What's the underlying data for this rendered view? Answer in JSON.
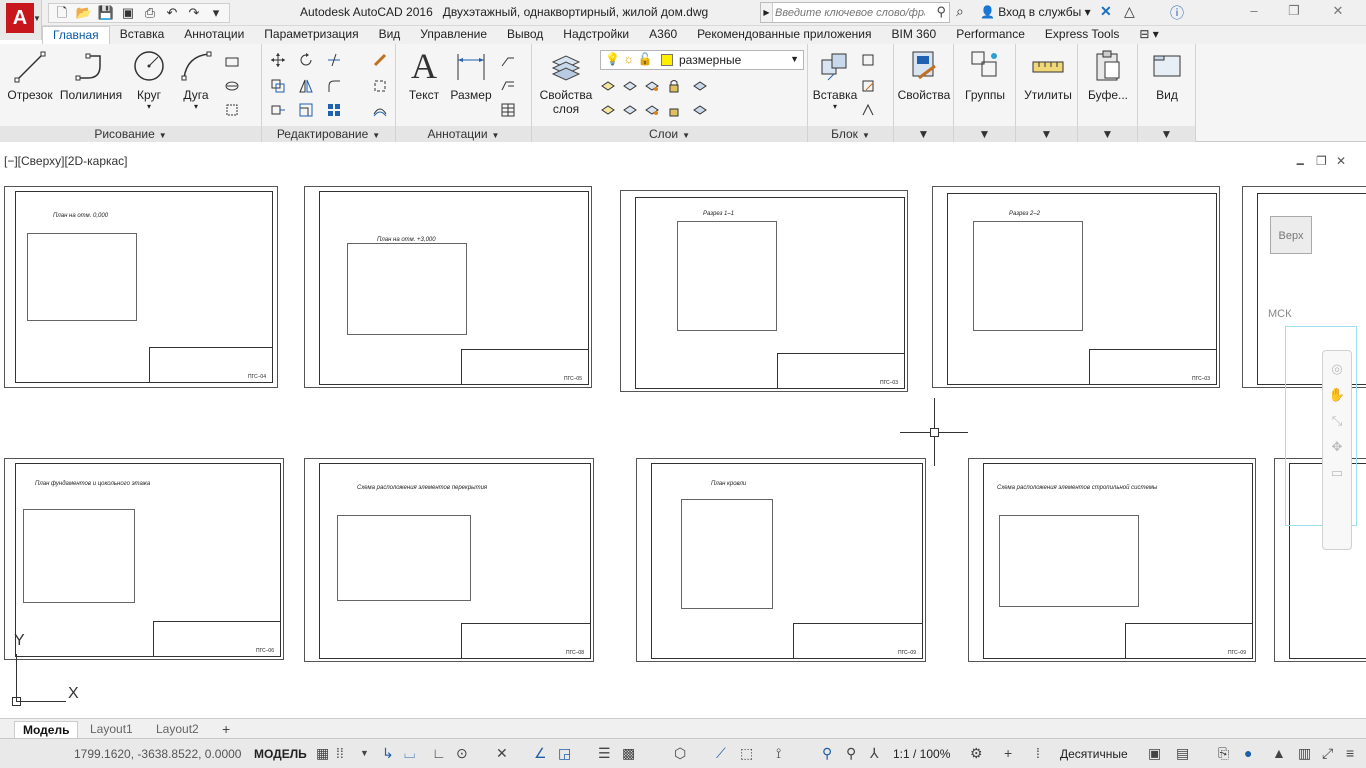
{
  "window": {
    "app_name": "Autodesk AutoCAD 2016",
    "file_name": "Двухэтажный, однаквортирный, жилой дом.dwg",
    "search_placeholder": "Введите ключевое слово/фразу",
    "login_label": "Вход в службы"
  },
  "ribbon_tabs": [
    "Главная",
    "Вставка",
    "Аннотации",
    "Параметризация",
    "Вид",
    "Управление",
    "Вывод",
    "Надстройки",
    "A360",
    "Рекомендованные приложения",
    "BIM 360",
    "Performance",
    "Express Tools"
  ],
  "active_tab": "Главная",
  "ribbon": {
    "draw": {
      "title": "Рисование",
      "line": "Отрезок",
      "polyline": "Полилиния",
      "circle": "Круг",
      "arc": "Дуга"
    },
    "modify": {
      "title": "Редактирование"
    },
    "annotation": {
      "title": "Аннотации",
      "text": "Текст",
      "dimension": "Размер"
    },
    "layers": {
      "title": "Слои",
      "properties_line1": "Свойства",
      "properties_line2": "слоя",
      "current_layer": "размерные"
    },
    "block": {
      "title": "Блок",
      "insert": "Вставка"
    },
    "properties": "Свойства",
    "groups": "Группы",
    "utilities": "Утилиты",
    "clipboard": "Буфе...",
    "view": "Вид"
  },
  "viewport": {
    "label": "[−][Сверху][2D-каркас]",
    "viewcube_top": "Верх",
    "ucs_name": "МСК"
  },
  "sheets": [
    {
      "title": "План на отм. 0,000",
      "code": "ПГС–04"
    },
    {
      "title": "План на отм. +3,000",
      "code": "ПГС–05"
    },
    {
      "title": "Разрез 1–1",
      "code": "ПГС–03"
    },
    {
      "title": "Разрез 2–2",
      "code": "ПГС–03"
    },
    {
      "title": "",
      "code": ""
    },
    {
      "title": "План фундаментов и цокольного этажа",
      "code": "ПГС–06"
    },
    {
      "title": "Схема расположения элементов перекрытия",
      "code": "ПГС–08"
    },
    {
      "title": "План кровли",
      "code": "ПГС–09"
    },
    {
      "title": "Схема расположения элементов стропильной системы",
      "code": "ПГС–09"
    },
    {
      "title": "",
      "code": ""
    }
  ],
  "ucs": {
    "x": "X",
    "y": "Y"
  },
  "layout_tabs": [
    "Модель",
    "Layout1",
    "Layout2"
  ],
  "status": {
    "coords": "1799.1620, -3638.8522, 0.0000",
    "space": "МОДЕЛЬ",
    "scale": "1:1 / 100%",
    "units": "Десятичные"
  },
  "colors": {
    "accent": "#0a5aa8",
    "app_red": "#c8161d",
    "layer_yellow": "#ffee00",
    "viewcube_cyan": "#9fe0ef"
  }
}
